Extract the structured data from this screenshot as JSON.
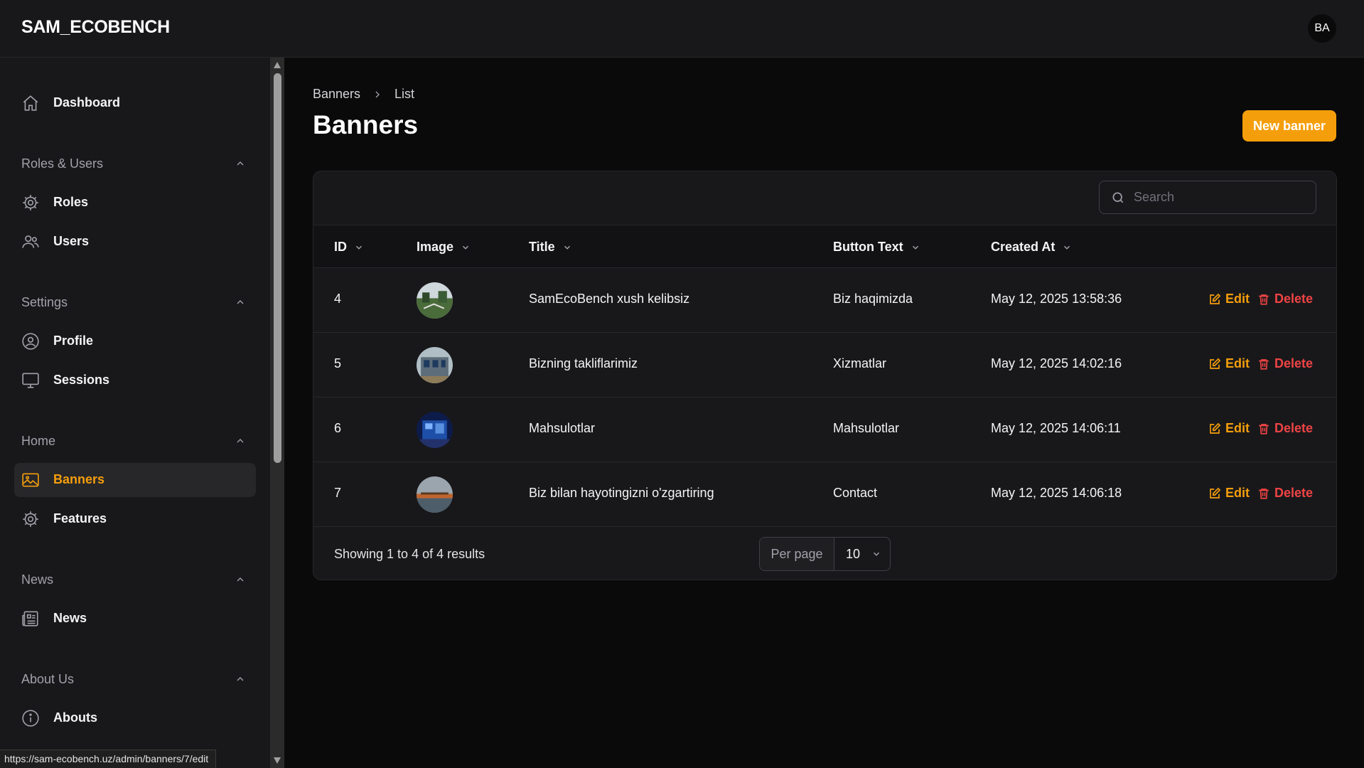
{
  "app": {
    "brand": "SAM_ECOBENCH",
    "avatar_initials": "BA"
  },
  "sidebar": {
    "dashboard": {
      "label": "Dashboard",
      "icon": "home-icon"
    },
    "groups": [
      {
        "label": "Roles & Users",
        "items": [
          {
            "label": "Roles",
            "icon": "gear-icon"
          },
          {
            "label": "Users",
            "icon": "users-icon"
          }
        ]
      },
      {
        "label": "Settings",
        "items": [
          {
            "label": "Profile",
            "icon": "user-circle-icon"
          },
          {
            "label": "Sessions",
            "icon": "monitor-icon"
          }
        ]
      },
      {
        "label": "Home",
        "items": [
          {
            "label": "Banners",
            "icon": "image-icon",
            "active": true
          },
          {
            "label": "Features",
            "icon": "gear-icon"
          }
        ]
      },
      {
        "label": "News",
        "items": [
          {
            "label": "News",
            "icon": "newspaper-icon"
          }
        ]
      },
      {
        "label": "About Us",
        "items": [
          {
            "label": "Abouts",
            "icon": "info-icon"
          }
        ]
      }
    ]
  },
  "breadcrumb": {
    "parent": "Banners",
    "current": "List"
  },
  "page": {
    "title": "Banners",
    "new_button": "New banner"
  },
  "search": {
    "placeholder": "Search",
    "value": ""
  },
  "table": {
    "columns": [
      "ID",
      "Image",
      "Title",
      "Button Text",
      "Created At"
    ],
    "rows": [
      {
        "id": "4",
        "title": "SamEcoBench xush kelibsiz",
        "button_text": "Biz haqimizda",
        "created_at": "May 12, 2025 13:58:36"
      },
      {
        "id": "5",
        "title": "Bizning takliflarimiz",
        "button_text": "Xizmatlar",
        "created_at": "May 12, 2025 14:02:16"
      },
      {
        "id": "6",
        "title": "Mahsulotlar",
        "button_text": "Mahsulotlar",
        "created_at": "May 12, 2025 14:06:11"
      },
      {
        "id": "7",
        "title": "Biz bilan hayotingizni o'zgartiring",
        "button_text": "Contact",
        "created_at": "May 12, 2025 14:06:18"
      }
    ],
    "actions": {
      "edit": "Edit",
      "delete": "Delete"
    }
  },
  "pagination": {
    "summary": "Showing 1 to 4 of 4 results",
    "per_page_label": "Per page",
    "per_page_value": "10"
  },
  "status_url": "https://sam-ecobench.uz/admin/banners/7/edit",
  "colors": {
    "accent": "#f59e0b",
    "danger": "#ef4444",
    "background": "#0a0a0b",
    "surface": "#18181b"
  }
}
